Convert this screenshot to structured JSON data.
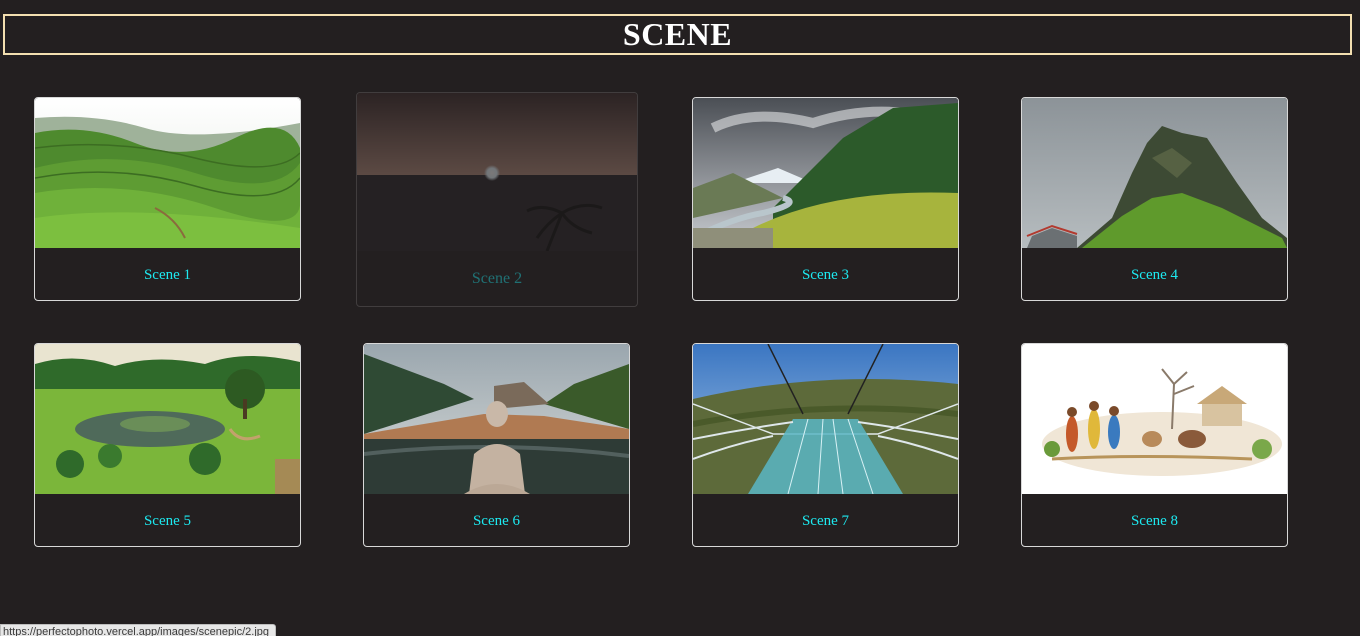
{
  "header": {
    "title": "SCENE"
  },
  "gallery": {
    "cards": [
      {
        "caption": "Scene 1",
        "image": "tea-plantation-hills"
      },
      {
        "caption": "Scene 2",
        "image": "sunset-over-sea",
        "state": "hovered"
      },
      {
        "caption": "Scene 3",
        "image": "mountain-valley-river"
      },
      {
        "caption": "Scene 4",
        "image": "misty-mountain-peak"
      },
      {
        "caption": "Scene 5",
        "image": "landscaped-garden-lake"
      },
      {
        "caption": "Scene 6",
        "image": "buddha-statue-lake"
      },
      {
        "caption": "Scene 7",
        "image": "glass-skywalk-bridge"
      },
      {
        "caption": "Scene 8",
        "image": "village-painting"
      }
    ]
  },
  "status_bar": {
    "url": "https://perfectophoto.vercel.app/images/scenepic/2.jpg"
  },
  "colors": {
    "background": "#231f20",
    "header_border": "#f3dfb0",
    "caption": "#1de9f0",
    "card_border": "#d8d8d8"
  }
}
